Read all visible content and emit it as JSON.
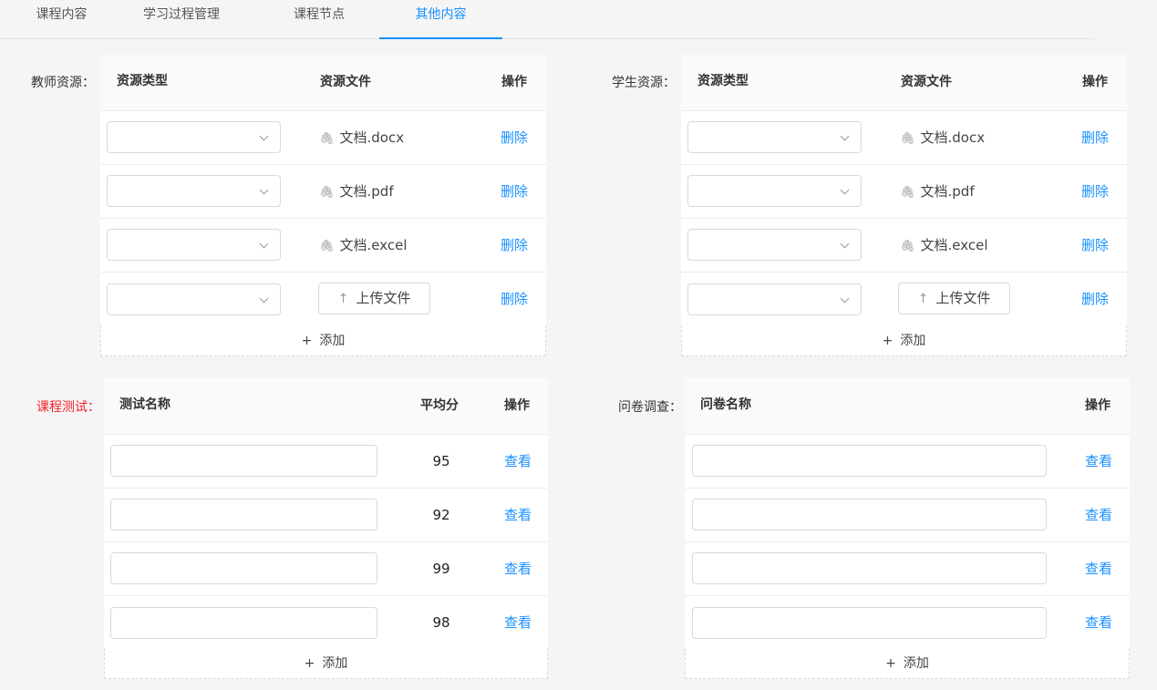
{
  "tabs": [
    {
      "label": "课程内容",
      "active": false
    },
    {
      "label": "学习过程管理",
      "active": false
    },
    {
      "label": "课程节点",
      "active": false
    },
    {
      "label": "其他内容",
      "active": true
    }
  ],
  "accent_color": "#1890ff",
  "required_color": "#f5222d",
  "teacher_resources": {
    "label": "教师资源：",
    "headers": {
      "type": "资源类型",
      "file": "资源文件",
      "action": "操作"
    },
    "rows": [
      {
        "type_value": "",
        "file": "文档.docx",
        "file_icon": "paperclip-icon",
        "action": "删除"
      },
      {
        "type_value": "",
        "file": "文档.pdf",
        "file_icon": "paperclip-icon",
        "action": "删除"
      },
      {
        "type_value": "",
        "file": "文档.excel",
        "file_icon": "paperclip-icon",
        "action": "删除"
      }
    ],
    "upload_row": {
      "type_value": "",
      "upload_label": "上传文件",
      "upload_icon": "upload-icon",
      "action": "删除"
    },
    "add_label": "添加"
  },
  "student_resources": {
    "label": "学生资源：",
    "headers": {
      "type": "资源类型",
      "file": "资源文件",
      "action": "操作"
    },
    "rows": [
      {
        "type_value": "",
        "file": "文档.docx",
        "file_icon": "paperclip-icon",
        "action": "删除"
      },
      {
        "type_value": "",
        "file": "文档.pdf",
        "file_icon": "paperclip-icon",
        "action": "删除"
      },
      {
        "type_value": "",
        "file": "文档.excel",
        "file_icon": "paperclip-icon",
        "action": "删除"
      }
    ],
    "upload_row": {
      "type_value": "",
      "upload_label": "上传文件",
      "upload_icon": "upload-icon",
      "action": "删除"
    },
    "add_label": "添加"
  },
  "course_tests": {
    "label": "课程测试：",
    "required": true,
    "headers": {
      "name": "测试名称",
      "score": "平均分",
      "action": "操作"
    },
    "rows": [
      {
        "name_value": "",
        "name_placeholder": "",
        "score": "95",
        "action": "查看"
      },
      {
        "name_value": "",
        "name_placeholder": "",
        "score": "92",
        "action": "查看"
      },
      {
        "name_value": "",
        "name_placeholder": "",
        "score": "99",
        "action": "查看"
      },
      {
        "name_value": "",
        "name_placeholder": "",
        "score": "98",
        "action": "查看"
      }
    ],
    "add_label": "添加"
  },
  "surveys": {
    "label": "问卷调查：",
    "headers": {
      "name": "问卷名称",
      "action": "操作"
    },
    "rows": [
      {
        "name_value": "",
        "name_placeholder": "",
        "action": "查看"
      },
      {
        "name_value": "",
        "name_placeholder": "",
        "action": "查看"
      },
      {
        "name_value": "",
        "name_placeholder": "",
        "action": "查看"
      },
      {
        "name_value": "",
        "name_placeholder": "",
        "action": "查看"
      }
    ],
    "add_label": "添加"
  }
}
